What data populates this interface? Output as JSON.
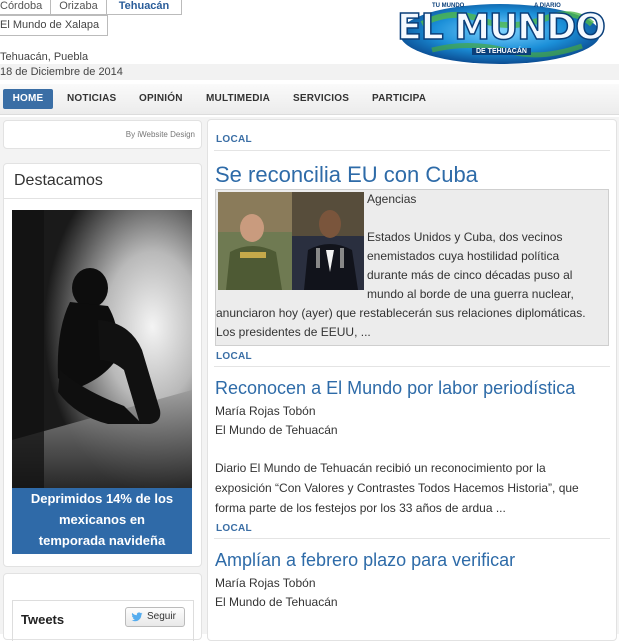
{
  "editions": {
    "tabs": [
      "Córdoba",
      "Orizaba",
      "Tehuacán"
    ],
    "second": "El Mundo de Xalapa"
  },
  "place": "Tehuacán, Puebla",
  "date": "18 de Diciembre de 2014",
  "logo": {
    "name": "EL MUNDO",
    "top_left": "TU MUNDO",
    "top_right": "A DIARIO",
    "sub": "DE TEHUACÁN"
  },
  "nav": [
    "HOME",
    "NOTICIAS",
    "OPINIÓN",
    "MULTIMEDIA",
    "SERVICIOS",
    "PARTICIPA"
  ],
  "sidebar": {
    "credit": "By iWebsite Design",
    "destacamos_title": "Destacamos",
    "destacamos_caption": [
      "Deprimidos 14% de los",
      "mexicanos en",
      "temporada navideña"
    ],
    "tweets_label": "Tweets",
    "follow_label": "Seguir"
  },
  "articles": [
    {
      "section": "LOCAL",
      "title": "Se reconcilia EU con Cuba",
      "source": "Agencias",
      "excerpt_lines": [
        "Estados Unidos y Cuba, dos vecinos",
        "enemistados cuya hostilidad política",
        "durante más de cinco décadas puso al",
        "mundo al borde de una guerra nuclear,",
        "anunciaron hoy (ayer) que restablecerán sus relaciones diplomáticas.",
        "Los presidentes de EEUU, ..."
      ]
    },
    {
      "section": "LOCAL",
      "title": "Reconocen a El Mundo por labor periodística",
      "author": "María Rojas Tobón",
      "outlet": "El Mundo de Tehuacán",
      "excerpt_lines": [
        "Diario El Mundo de Tehuacán recibió un reconocimiento por la",
        "exposición “Con Valores y Contrastes Todos Hacemos Historia”, que",
        "forma parte de los festejos por los 33 años de ardua ..."
      ]
    },
    {
      "section": "LOCAL",
      "title": "Amplían a febrero plazo para verificar",
      "author": "María Rojas Tobón",
      "outlet": "El Mundo de Tehuacán"
    }
  ]
}
